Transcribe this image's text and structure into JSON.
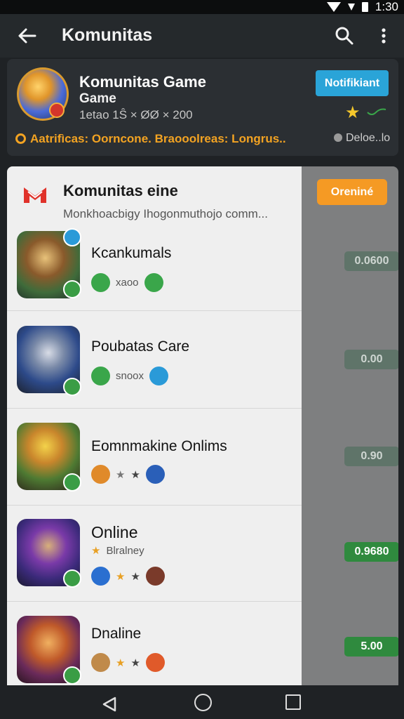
{
  "status_bar": {
    "time": "1:30"
  },
  "app_bar": {
    "title": "Komunitas"
  },
  "featured": {
    "title": "Komunitas Game",
    "subtitle": "Game",
    "meta": "1etao 1Ŝ × ØØ × 200",
    "notify_label": "Notifikiant",
    "tags": "Aatrifìcas: Oorncone. Braooolreas: Longrus..",
    "extra": "Deloe..lo"
  },
  "panel": {
    "title": "Komunitas eine",
    "subtitle": "Monkhoacbigy Ihogonmuthojo comm..."
  },
  "online_label": "Oreniné",
  "items": [
    {
      "name": "Kcankumals",
      "tag": "xaoo",
      "price": "0.0600"
    },
    {
      "name": "Poubatas Care",
      "tag": "snoox",
      "price": "0.00"
    },
    {
      "name": "Eomnmakine Onlims",
      "tag": "",
      "price": "0.90"
    },
    {
      "name": "Online",
      "tag": "Blralney",
      "price": "0.9680"
    },
    {
      "name": "Dnaline",
      "tag": "",
      "price": "5.00"
    }
  ],
  "colors": {
    "accent_blue": "#2aa4d8",
    "accent_orange": "#f59a24",
    "badge_green": "#3a9d45",
    "price_green": "#2f8a3e"
  }
}
